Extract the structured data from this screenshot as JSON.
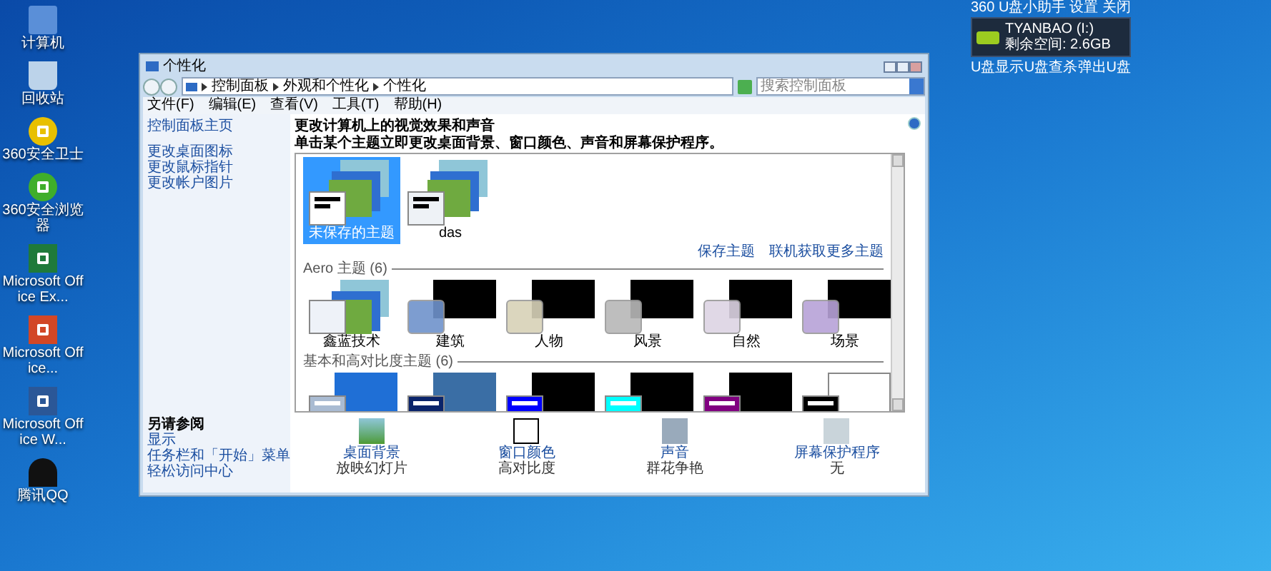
{
  "desktop_icons": [
    {
      "label": "计算机",
      "kind": "computer"
    },
    {
      "label": "回收站",
      "kind": "trash"
    },
    {
      "label": "360安全卫士",
      "kind": "guard"
    },
    {
      "label": "360安全浏览器",
      "kind": "browser"
    },
    {
      "label": "Microsoft Office Ex...",
      "kind": "excel"
    },
    {
      "label": "Microsoft Office...",
      "kind": "powerpoint"
    },
    {
      "label": "Microsoft Office W...",
      "kind": "word"
    },
    {
      "label": "腾讯QQ",
      "kind": "qq"
    }
  ],
  "usb_widget": {
    "title": "360 U盘小助手",
    "settings": "设置",
    "close": "关闭",
    "drive": "TYANBAO (I:)",
    "free_space": "剩余空间: 2.6GB",
    "actions": [
      "U盘显示",
      "U盘查杀",
      "弹出U盘"
    ]
  },
  "window": {
    "title": "个性化",
    "breadcrumb": [
      "控制面板",
      "外观和个性化",
      "个性化"
    ],
    "search": {
      "placeholder": "搜索控制面板"
    },
    "menu": [
      "文件(F)",
      "编辑(E)",
      "查看(V)",
      "工具(T)",
      "帮助(H)"
    ],
    "sidebar": {
      "home": "控制面板主页",
      "links": [
        "更改桌面图标",
        "更改鼠标指针",
        "更改帐户图片"
      ]
    },
    "heading": "更改计算机上的视觉效果和声音",
    "subheading": "单击某个主题立即更改桌面背景、窗口颜色、声音和屏幕保护程序。",
    "my_themes": [
      {
        "label": "未保存的主题",
        "kind": "photo",
        "selected": true,
        "color": "#ffffff"
      },
      {
        "label": "das",
        "kind": "photo",
        "selected": false,
        "color": "#eef2f6"
      }
    ],
    "theme_links": [
      "保存主题",
      "联机获取更多主题"
    ],
    "aero_header": "Aero 主题 (6)",
    "aero_themes": [
      {
        "label": "鑫蓝技术",
        "kind": "photo",
        "selected": false,
        "color": "#eef2f8"
      },
      {
        "label": "建筑",
        "kind": "aero",
        "selected": false,
        "color": "#6f93cc"
      },
      {
        "label": "人物",
        "kind": "aero",
        "selected": false,
        "color": "#d8d2b8"
      },
      {
        "label": "风景",
        "kind": "aero",
        "selected": false,
        "color": "#b8b8b8"
      },
      {
        "label": "自然",
        "kind": "aero",
        "selected": false,
        "color": "#ddd4e4"
      },
      {
        "label": "场景",
        "kind": "aero",
        "selected": false,
        "color": "#b7a2d8"
      }
    ],
    "basic_header": "基本和高对比度主题 (6)",
    "basic_themes": [
      {
        "kind": "basic",
        "selected": false,
        "color": "#a9bbd2"
      },
      {
        "kind": "classic",
        "selected": false,
        "color": "#0a246a"
      },
      {
        "kind": "contrast",
        "selected": false,
        "color": "#0000ff"
      },
      {
        "kind": "contrast",
        "selected": false,
        "color": "#00ffff"
      },
      {
        "kind": "contrast",
        "selected": false,
        "color": "#800080"
      },
      {
        "kind": "contrast-white",
        "selected": false,
        "color": "#000000"
      }
    ],
    "see_also": {
      "title": "另请参阅",
      "links": [
        "显示",
        "任务栏和「开始」菜单",
        "轻松访问中心"
      ]
    },
    "settings": [
      {
        "kind": "background",
        "label": "桌面背景",
        "value": "放映幻灯片"
      },
      {
        "kind": "color",
        "label": "窗口颜色",
        "value": "高对比度"
      },
      {
        "kind": "sound",
        "label": "声音",
        "value": "群花争艳"
      },
      {
        "kind": "screensaver",
        "label": "屏幕保护程序",
        "value": "无"
      }
    ]
  }
}
